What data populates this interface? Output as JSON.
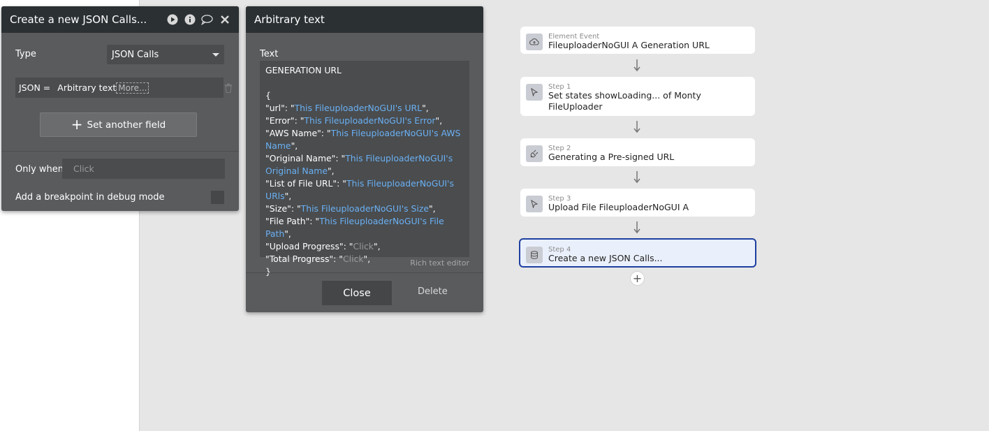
{
  "action_panel": {
    "title": "Create a new JSON Calls...",
    "type_label": "Type",
    "type_value": "JSON Calls",
    "json_key": "JSON =",
    "json_value": "Arbitrary text",
    "more_label": "More...",
    "set_field_label": "Set another field",
    "only_when_label": "Only when",
    "only_when_placeholder": "Click",
    "breakpoint_label": "Add a breakpoint in debug mode"
  },
  "text_panel": {
    "title": "Arbitrary text",
    "text_label": "Text",
    "lines": [
      [
        {
          "t": "GENERATION URL"
        }
      ],
      [],
      [
        {
          "t": "{"
        }
      ],
      [
        {
          "t": "\"url\": \""
        },
        {
          "d": "This FileuploaderNoGUI's URL"
        },
        {
          "t": "\","
        }
      ],
      [
        {
          "t": "\"Error\": \""
        },
        {
          "d": "This FileuploaderNoGUI's Error"
        },
        {
          "t": "\","
        }
      ],
      [
        {
          "t": "\"AWS Name\": \""
        },
        {
          "d": "This FileuploaderNoGUI's AWS Name"
        },
        {
          "t": "\","
        }
      ],
      [
        {
          "t": "\"Original Name\": \""
        },
        {
          "d": "This FileuploaderNoGUI's Original Name"
        },
        {
          "t": "\","
        }
      ],
      [
        {
          "t": "\"List of File URL\": \""
        },
        {
          "d": "This FileuploaderNoGUI's URls"
        },
        {
          "t": "\","
        }
      ],
      [
        {
          "t": "\"Size\": \""
        },
        {
          "d": "This FileuploaderNoGUI's Size"
        },
        {
          "t": "\","
        }
      ],
      [
        {
          "t": "\"File Path\": \""
        },
        {
          "d": "This FileuploaderNoGUI's File Path"
        },
        {
          "t": "\","
        }
      ],
      [
        {
          "t": "\"Upload Progress\": \""
        },
        {
          "p": "Click"
        },
        {
          "t": "\","
        }
      ],
      [
        {
          "t": "\"Total Progress\": \""
        },
        {
          "p": "Click"
        },
        {
          "t": "\","
        }
      ],
      [
        {
          "t": "}"
        }
      ]
    ],
    "rich_text_label": "Rich text editor",
    "close_label": "Close",
    "delete_label": "Delete"
  },
  "workflow": {
    "steps": [
      {
        "small": "Element Event",
        "title": "FileuploaderNoGUI A Generation URL",
        "icon": "cloud-upload-icon"
      },
      {
        "small": "Step 1",
        "title": "Set states showLoading... of Monty FileUploader",
        "icon": "cursor-icon"
      },
      {
        "small": "Step 2",
        "title": "Generating a Pre-signed URL",
        "icon": "plug-icon"
      },
      {
        "small": "Step 3",
        "title": "Upload File FileuploaderNoGUI A",
        "icon": "cursor-icon"
      },
      {
        "small": "Step 4",
        "title": "Create a new JSON Calls...",
        "icon": "database-icon"
      }
    ],
    "add_label": "+"
  },
  "colors": {
    "panel_bg": "#595b5d",
    "panel_header": "#2b3033",
    "dynamic_text": "#6ab0f3",
    "active_step_border": "#1e3fa0"
  }
}
